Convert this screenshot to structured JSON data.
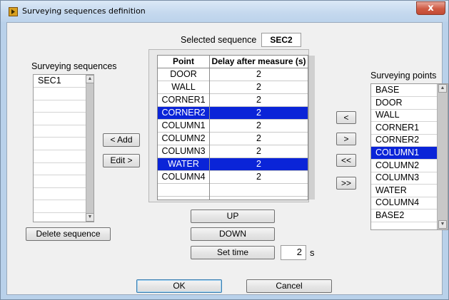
{
  "window": {
    "title": "Surveying sequences definition",
    "close_glyph": "x"
  },
  "selected_sequence": {
    "label": "Selected sequence",
    "value": "SEC2"
  },
  "sequences": {
    "label": "Surveying sequences",
    "items": [
      "SEC1",
      "",
      "",
      "",
      "",
      "",
      "",
      "",
      "",
      "",
      ""
    ]
  },
  "buttons": {
    "add": "< Add",
    "edit": "Edit >",
    "delete_sequence": "Delete sequence",
    "up": "UP",
    "down": "DOWN",
    "set_time": "Set time",
    "move_left": "<",
    "move_right": ">",
    "move_all_left": "<<",
    "move_all_right": ">>",
    "ok": "OK",
    "cancel": "Cancel"
  },
  "set_time": {
    "value": "2",
    "unit": "s"
  },
  "table": {
    "headers": [
      "Point",
      "Delay after measure (s)"
    ],
    "rows": [
      {
        "point": "DOOR",
        "delay": "2",
        "selected": false
      },
      {
        "point": "WALL",
        "delay": "2",
        "selected": false
      },
      {
        "point": "CORNER1",
        "delay": "2",
        "selected": false
      },
      {
        "point": "CORNER2",
        "delay": "2",
        "selected": true
      },
      {
        "point": "COLUMN1",
        "delay": "2",
        "selected": false
      },
      {
        "point": "COLUMN2",
        "delay": "2",
        "selected": false
      },
      {
        "point": "COLUMN3",
        "delay": "2",
        "selected": false
      },
      {
        "point": "WATER",
        "delay": "2",
        "selected": true
      },
      {
        "point": "COLUMN4",
        "delay": "2",
        "selected": false
      }
    ]
  },
  "points": {
    "label": "Surveying points",
    "items": [
      "BASE",
      "DOOR",
      "WALL",
      "CORNER1",
      "CORNER2",
      "COLUMN1",
      "COLUMN2",
      "COLUMN3",
      "WATER",
      "COLUMN4",
      "BASE2"
    ],
    "selected_index": 5
  },
  "colors": {
    "selection": "#0a24d8",
    "client_bg": "#f0f0f0",
    "frame": "#b9d1ea"
  }
}
